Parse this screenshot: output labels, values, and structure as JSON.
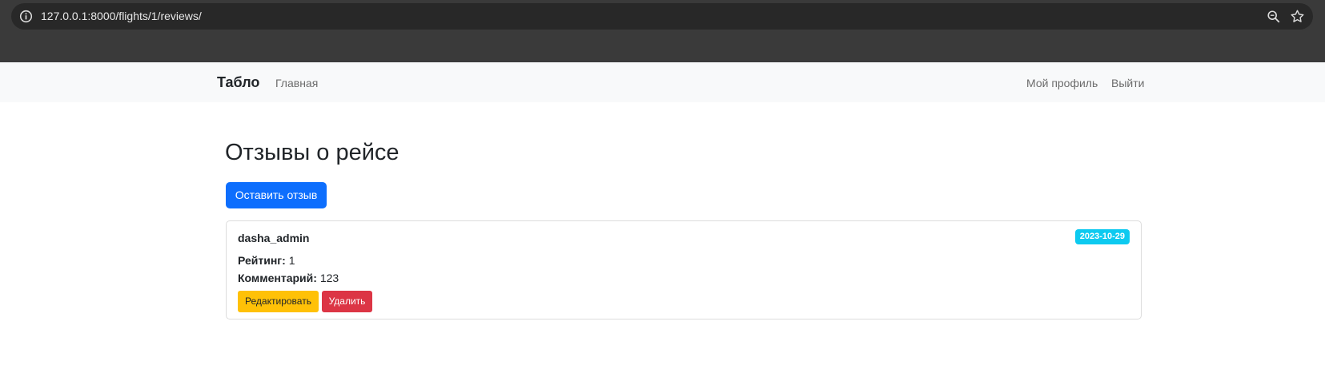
{
  "browser": {
    "url": "127.0.0.1:8000/flights/1/reviews/",
    "icons": [
      "info-icon",
      "zoom-icon",
      "star-icon"
    ]
  },
  "navbar": {
    "brand": "Табло",
    "home": "Главная",
    "profile": "Мой профиль",
    "logout": "Выйти"
  },
  "main": {
    "title": "Отзывы о рейсе",
    "add_review_label": "Оставить отзыв"
  },
  "reviews": [
    {
      "user": "dasha_admin",
      "date": "2023-10-29",
      "rating_label": "Рейтинг:",
      "rating_value": "1",
      "comment_label": "Комментарий:",
      "comment_value": "123",
      "edit_label": "Редактировать",
      "delete_label": "Удалить"
    }
  ],
  "colors": {
    "primary": "#0d6efd",
    "warning": "#ffc107",
    "danger": "#dc3545",
    "info": "#0dcaf0"
  }
}
